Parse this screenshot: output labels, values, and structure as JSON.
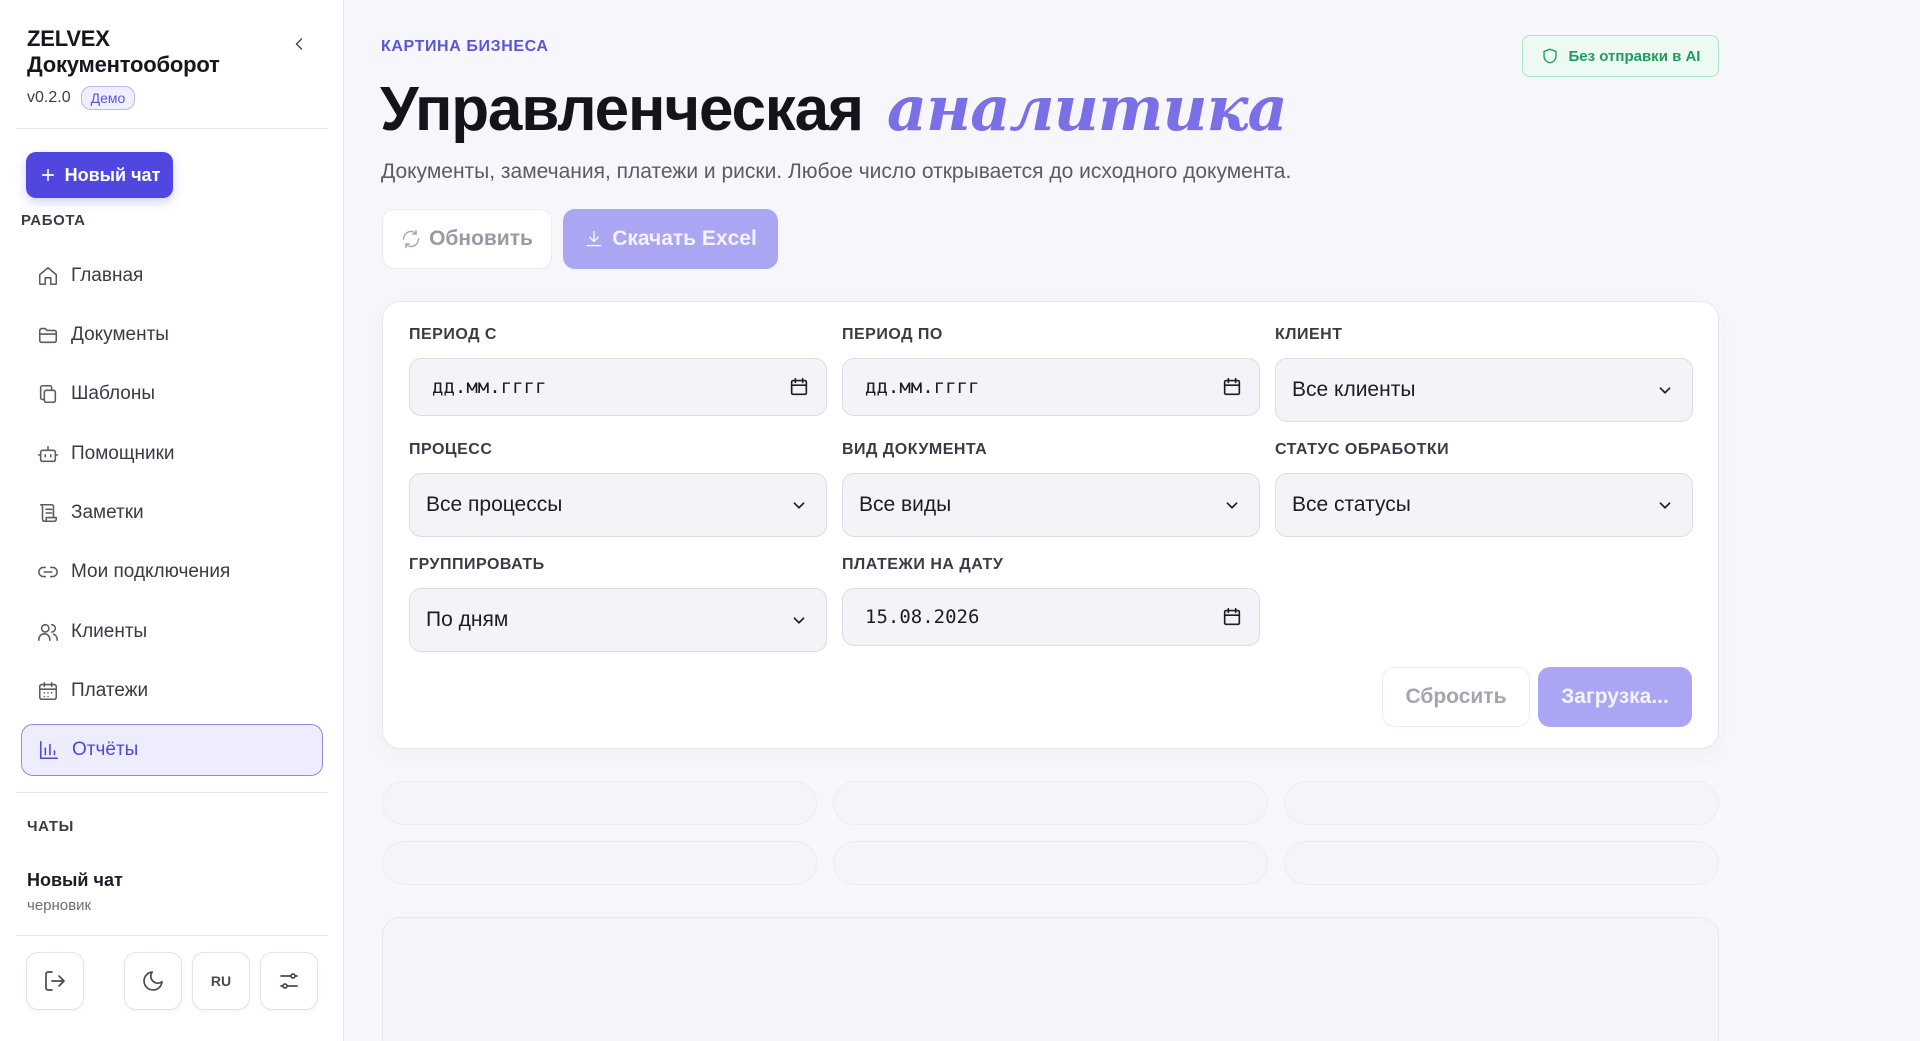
{
  "sidebar": {
    "brand_name": "ZELVEX Документооборот",
    "version": "v0.2.0",
    "demo_badge": "Демо",
    "new_chat_label": "Новый чат",
    "work_section_label": "РАБОТА",
    "items": [
      {
        "label": "Главная",
        "icon": "home-icon"
      },
      {
        "label": "Документы",
        "icon": "folder-icon"
      },
      {
        "label": "Шаблоны",
        "icon": "copy-icon"
      },
      {
        "label": "Помощники",
        "icon": "bot-icon"
      },
      {
        "label": "Заметки",
        "icon": "scroll-icon"
      },
      {
        "label": "Мои подключения",
        "icon": "link-icon"
      },
      {
        "label": "Клиенты",
        "icon": "users-icon"
      },
      {
        "label": "Платежи",
        "icon": "calendar-icon"
      },
      {
        "label": "Отчёты",
        "icon": "bar-chart-icon",
        "active": true
      }
    ],
    "chats_section_label": "ЧАТЫ",
    "chat": {
      "title": "Новый чат",
      "subtitle": "черновик"
    },
    "footer": {
      "lang_label": "RU"
    }
  },
  "header": {
    "eyebrow": "КАРТИНА БИЗНЕСА",
    "privacy_badge": "Без отправки в AI",
    "title_main": "Управленческая",
    "title_accent": "аналитика",
    "subtitle": "Документы, замечания, платежи и риски. Любое число открывается до исходного документа.",
    "refresh_label": "Обновить",
    "excel_label": "Скачать Excel"
  },
  "filters": {
    "period_from": {
      "label": "ПЕРИОД С",
      "value": "дд.мм.гггг"
    },
    "period_to": {
      "label": "ПЕРИОД ПО",
      "value": "дд.мм.гггг"
    },
    "client": {
      "label": "КЛИЕНТ",
      "value": "Все клиенты"
    },
    "process": {
      "label": "ПРОЦЕСС",
      "value": "Все процессы"
    },
    "doc_type": {
      "label": "ВИД ДОКУМЕНТА",
      "value": "Все виды"
    },
    "status": {
      "label": "СТАТУС ОБРАБОТКИ",
      "value": "Все статусы"
    },
    "group_by": {
      "label": "ГРУППИРОВАТЬ",
      "value": "По дням"
    },
    "payments_date": {
      "label": "ПЛАТЕЖИ НА ДАТУ",
      "value": "15.08.2026"
    },
    "reset_label": "Сбросить",
    "load_label": "Загрузка..."
  },
  "colors": {
    "accent": "#4f47e0",
    "accent_light": "#aba6f3",
    "title_accent": "#7b6fe8",
    "success": "#1f9b5e"
  }
}
